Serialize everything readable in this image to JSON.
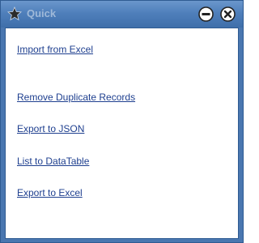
{
  "window": {
    "title": "Quick",
    "icons": {
      "title": "star-icon",
      "minimize": "minimize-icon",
      "close": "close-icon"
    }
  },
  "links": [
    {
      "label": "Import from Excel"
    },
    {
      "label": "Remove Duplicate Records"
    },
    {
      "label": "Export to JSON"
    },
    {
      "label": "List to DataTable"
    },
    {
      "label": "Export to Excel"
    }
  ],
  "colors": {
    "titlebar": "#4f7fbb",
    "link": "#1e3f8f",
    "title_text": "#9fb9d9"
  }
}
